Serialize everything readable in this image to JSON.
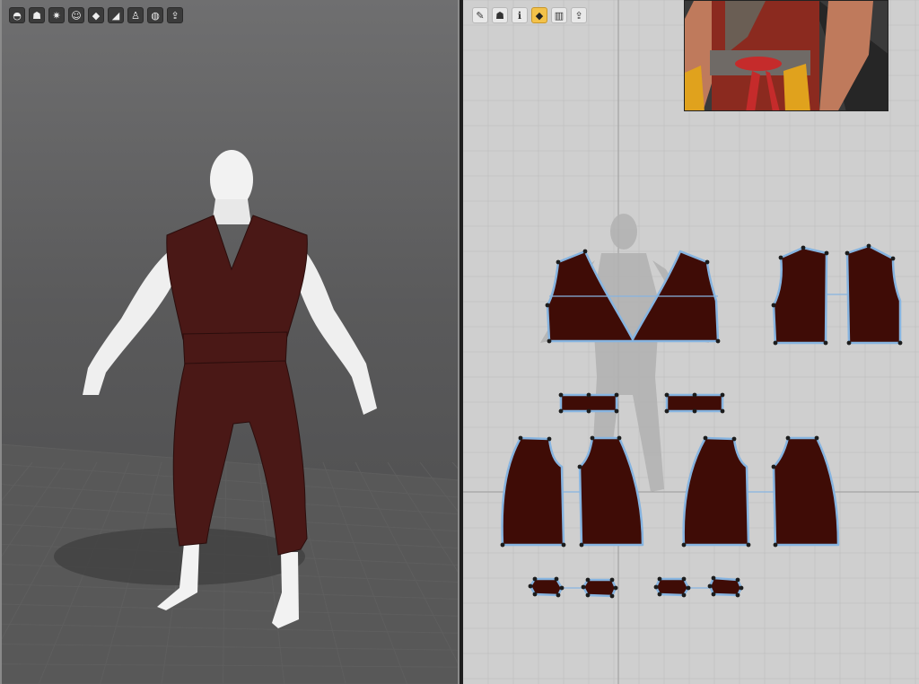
{
  "viewport3d": {
    "toolbar": [
      {
        "icon": "helmet-icon",
        "glyph": "◓"
      },
      {
        "icon": "shirt-icon",
        "glyph": "☗"
      },
      {
        "icon": "sparkle-icon",
        "glyph": "✷"
      },
      {
        "icon": "avatar-icon",
        "glyph": "☺"
      },
      {
        "icon": "texture-icon",
        "glyph": "◆"
      },
      {
        "icon": "surface-icon",
        "glyph": "◢"
      },
      {
        "icon": "figure-icon",
        "glyph": "♙"
      },
      {
        "icon": "globe-icon",
        "glyph": "◍"
      },
      {
        "icon": "export-icon",
        "glyph": "⇪"
      }
    ],
    "garment_color": "#4a1816",
    "skin_color": "#f1f1f1",
    "grid_color": "#5e5e5e"
  },
  "pattern2d": {
    "toolbar": [
      {
        "icon": "pencil-icon",
        "glyph": "✎"
      },
      {
        "icon": "pattern-shirt-icon",
        "glyph": "☗"
      },
      {
        "icon": "info-icon",
        "glyph": "ℹ"
      },
      {
        "icon": "texture-2d-icon",
        "glyph": "◆",
        "active": true
      },
      {
        "icon": "layers-icon",
        "glyph": "▥"
      },
      {
        "icon": "export-2d-icon",
        "glyph": "⇪"
      }
    ],
    "piece_fill": "#3f0c06",
    "piece_outline": "#86b4e0",
    "grid_color": "#bdbdbd"
  }
}
